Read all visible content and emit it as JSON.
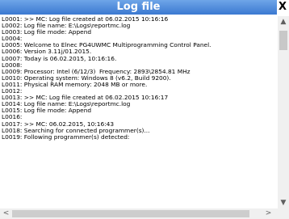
{
  "window": {
    "title": "Log file",
    "close_label": "X"
  },
  "log": {
    "lines": [
      "L0001: >> MC: Log file created at 06.02.2015 10:16:16",
      "L0002: Log file name: E:\\Logs\\reportmc.log",
      "L0003: Log file mode: Append",
      "L0004:",
      "L0005: Welcome to Elnec PG4UWMC Multiprogramming Control Panel.",
      "L0006: Version 3.11j/01.2015.",
      "L0007: Today is 06.02.2015, 10:16:16.",
      "L0008:",
      "L0009: Processor: Intel (6/12/3)  Frequency: 2893\\2854.81 MHz",
      "L0010: Operating system: Windows 8 (v6.2, Build 9200).",
      "L0011: Physical RAM memory: 2048 MB or more.",
      "L0012:",
      "L0013: >> MC: Log file created at 06.02.2015 10:16:17",
      "L0014: Log file name: E:\\Logs\\reportmc.log",
      "L0015: Log file mode: Append",
      "L0016:",
      "L0017: >> MC: 06.02.2015, 10:16:43",
      "L0018: Searching for connected programmer(s)...",
      "L0019: Following programmer(s) detected:"
    ]
  },
  "scrollbars": {
    "up_icon": "▲",
    "down_icon": "▼",
    "left_icon": "<",
    "right_icon": ">"
  }
}
